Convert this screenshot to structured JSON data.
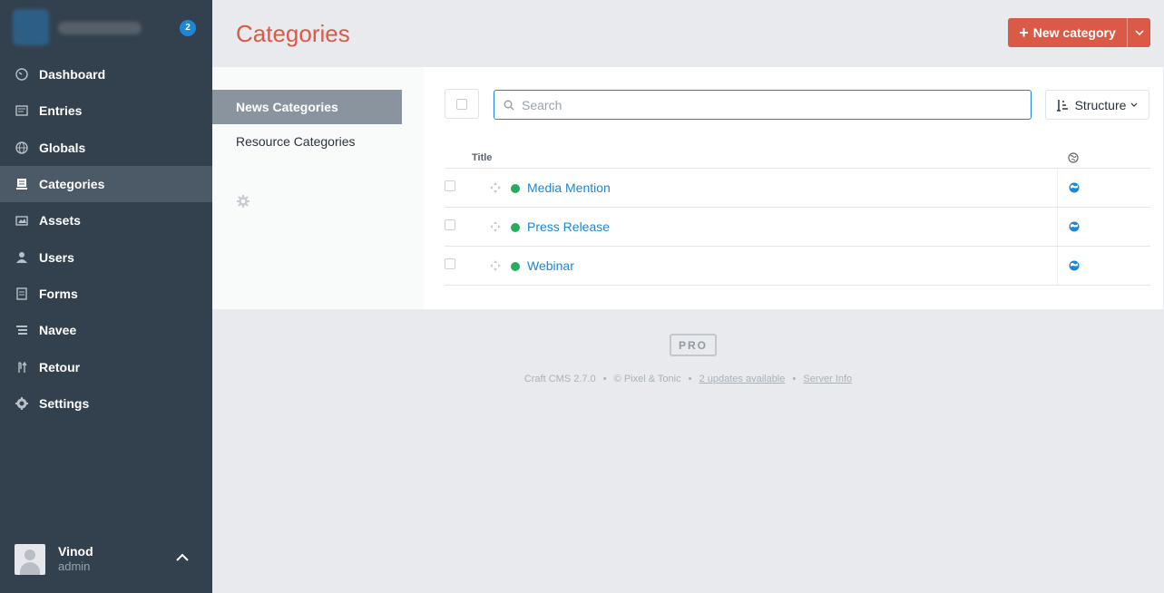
{
  "sidebar": {
    "update_count": "2",
    "items": [
      {
        "label": "Dashboard",
        "icon": "dashboard-icon"
      },
      {
        "label": "Entries",
        "icon": "entries-icon"
      },
      {
        "label": "Globals",
        "icon": "globe-icon"
      },
      {
        "label": "Categories",
        "icon": "categories-icon",
        "active": true
      },
      {
        "label": "Assets",
        "icon": "assets-icon"
      },
      {
        "label": "Users",
        "icon": "users-icon"
      },
      {
        "label": "Forms",
        "icon": "forms-icon"
      },
      {
        "label": "Navee",
        "icon": "navee-icon"
      },
      {
        "label": "Retour",
        "icon": "retour-icon"
      },
      {
        "label": "Settings",
        "icon": "settings-icon"
      }
    ],
    "user": {
      "name": "Vinod",
      "role": "admin"
    }
  },
  "header": {
    "title": "Categories",
    "new_button_label": "New category"
  },
  "groups": {
    "items": [
      {
        "label": "News Categories",
        "active": true
      },
      {
        "label": "Resource Categories",
        "active": false
      }
    ]
  },
  "toolbar": {
    "search_placeholder": "Search",
    "structure_label": "Structure"
  },
  "table": {
    "columns": {
      "title": "Title"
    },
    "rows": [
      {
        "title": "Media Mention",
        "status": "enabled"
      },
      {
        "title": "Press Release",
        "status": "enabled"
      },
      {
        "title": "Webinar",
        "status": "enabled"
      }
    ]
  },
  "footer": {
    "edition": "PRO",
    "version": "Craft CMS 2.7.0",
    "copyright": "© Pixel & Tonic",
    "updates": "2 updates available",
    "server_info": "Server Info"
  },
  "colors": {
    "accent": "#da5a47",
    "sidebar_bg": "#33404d",
    "link": "#1b87d6",
    "status_enabled": "#27ab5f"
  }
}
